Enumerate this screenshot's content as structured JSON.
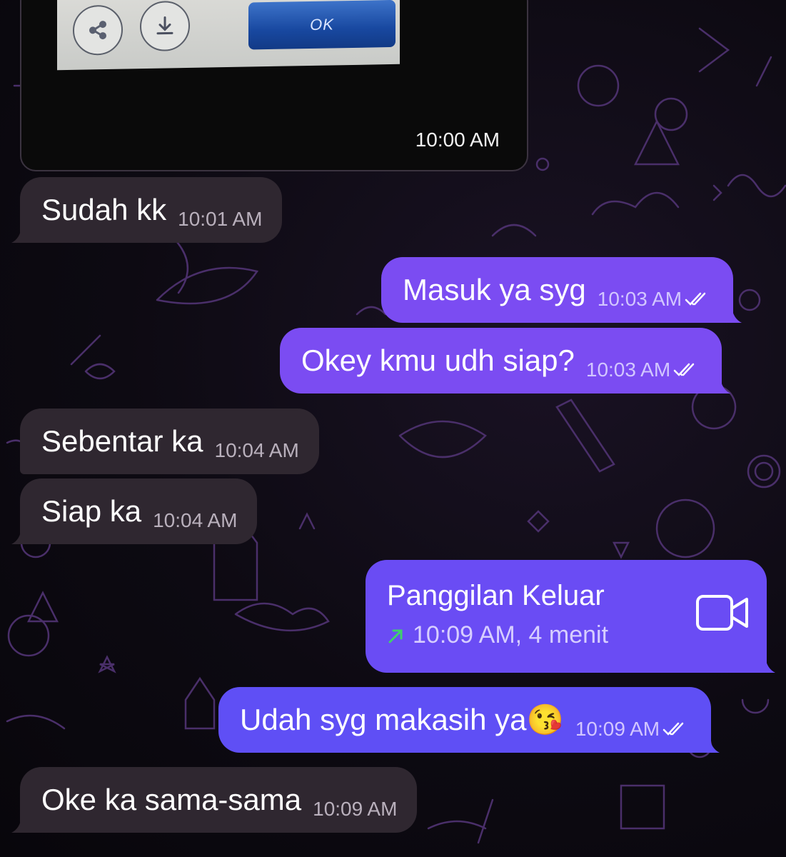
{
  "colors": {
    "incoming_bubble": "#2f2730",
    "outgoing_bubble": "#7b4cf2",
    "call_bubble": "#6a4cf4",
    "background": "#0b0810",
    "doodle_stroke": "#4a2f6a",
    "call_arrow": "#3fd16a"
  },
  "photo": {
    "ok_label": "OK",
    "time": "10:00 AM",
    "share_icon": "share-icon",
    "download_icon": "download-icon"
  },
  "messages": [
    {
      "dir": "in",
      "text": "Sudah kk",
      "time": "10:01 AM"
    },
    {
      "dir": "out",
      "text": "Masuk ya syg",
      "time": "10:03 AM",
      "read": true
    },
    {
      "dir": "out",
      "text": "Okey kmu udh siap?",
      "time": "10:03 AM",
      "read": true
    },
    {
      "dir": "in",
      "text": "Sebentar ka",
      "time": "10:04 AM"
    },
    {
      "dir": "in",
      "text": "Siap ka",
      "time": "10:04 AM"
    },
    {
      "dir": "out",
      "text": "Udah syg makasih ya😘",
      "time": "10:09 AM",
      "read": true
    },
    {
      "dir": "in",
      "text": "Oke ka sama-sama",
      "time": "10:09 AM"
    }
  ],
  "call": {
    "title": "Panggilan Keluar",
    "detail": "10:09 AM, 4 menit",
    "icon": "video-camera-icon",
    "direction_icon": "outgoing-arrow-icon"
  }
}
